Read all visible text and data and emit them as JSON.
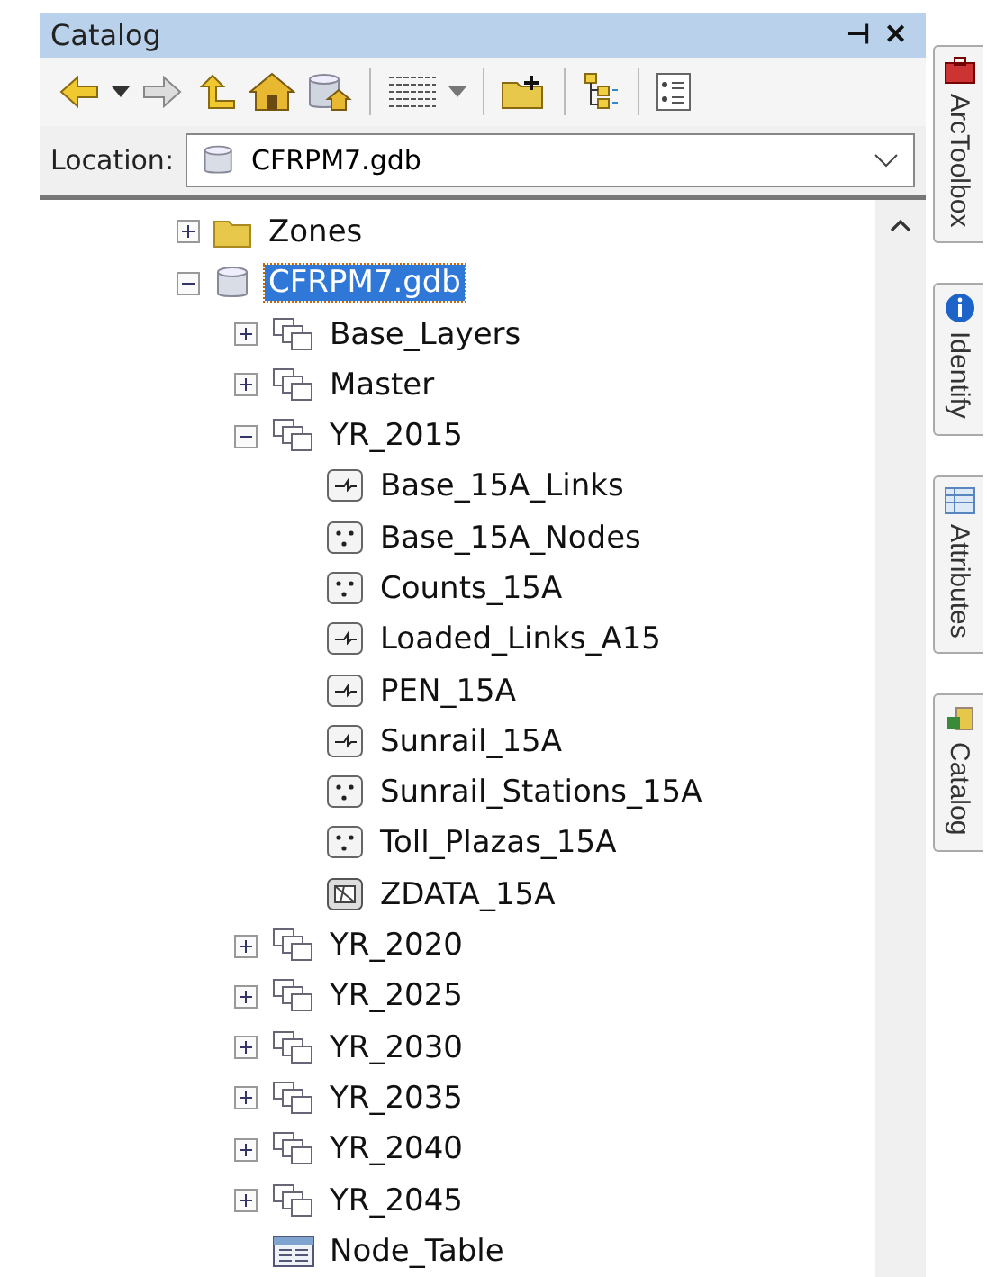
{
  "window": {
    "title": "Catalog",
    "pin": "⊣",
    "close": "✕"
  },
  "location": {
    "label": "Location:",
    "value": "CFRPM7.gdb"
  },
  "tree": [
    {
      "label": "Zones",
      "kind": "folder",
      "selected": false,
      "expanded": false
    },
    {
      "label": "CFRPM7.gdb",
      "kind": "database",
      "selected": true,
      "expanded": true,
      "children": [
        {
          "label": "Base_Layers",
          "kind": "dataset",
          "selected": false,
          "expanded": false
        },
        {
          "label": "Master",
          "kind": "dataset",
          "selected": false,
          "expanded": false
        },
        {
          "label": "YR_2015",
          "kind": "dataset",
          "selected": false,
          "expanded": true,
          "children": [
            {
              "label": "Base_15A_Links",
              "kind": "line",
              "selected": false
            },
            {
              "label": "Base_15A_Nodes",
              "kind": "point",
              "selected": false
            },
            {
              "label": "Counts_15A",
              "kind": "point",
              "selected": false
            },
            {
              "label": "Loaded_Links_A15",
              "kind": "line",
              "selected": false
            },
            {
              "label": "PEN_15A",
              "kind": "line",
              "selected": false
            },
            {
              "label": "Sunrail_15A",
              "kind": "line",
              "selected": false
            },
            {
              "label": "Sunrail_Stations_15A",
              "kind": "point",
              "selected": false
            },
            {
              "label": "Toll_Plazas_15A",
              "kind": "point",
              "selected": false
            },
            {
              "label": "ZDATA_15A",
              "kind": "polygon",
              "selected": false
            }
          ]
        },
        {
          "label": "YR_2020",
          "kind": "dataset",
          "selected": false,
          "expanded": false
        },
        {
          "label": "YR_2025",
          "kind": "dataset",
          "selected": false,
          "expanded": false
        },
        {
          "label": "YR_2030",
          "kind": "dataset",
          "selected": false,
          "expanded": false
        },
        {
          "label": "YR_2035",
          "kind": "dataset",
          "selected": false,
          "expanded": false
        },
        {
          "label": "YR_2040",
          "kind": "dataset",
          "selected": false,
          "expanded": false
        },
        {
          "label": "YR_2045",
          "kind": "dataset",
          "selected": false,
          "expanded": false
        },
        {
          "label": "Node_Table",
          "kind": "table",
          "selected": false
        }
      ]
    }
  ],
  "dock_tabs": [
    {
      "label": "ArcToolbox",
      "kind": "toolbox"
    },
    {
      "label": "Identify",
      "kind": "identify"
    },
    {
      "label": "Attributes",
      "kind": "attributes"
    },
    {
      "label": "Catalog",
      "kind": "catalog"
    }
  ]
}
